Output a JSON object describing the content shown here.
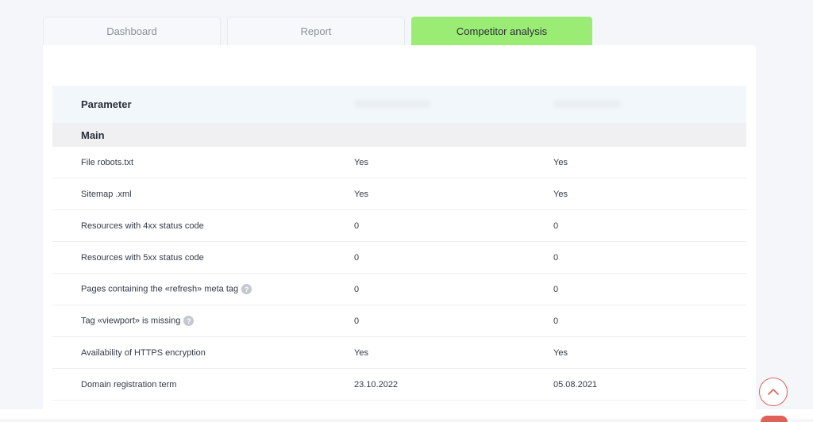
{
  "tabs": [
    {
      "label": "Dashboard",
      "active": false
    },
    {
      "label": "Report",
      "active": false
    },
    {
      "label": "Competitor analysis",
      "active": true
    }
  ],
  "table": {
    "header": {
      "parameter": "Parameter"
    },
    "section": "Main",
    "rows": [
      {
        "label": "File robots.txt",
        "v1": "Yes",
        "v2": "Yes",
        "help": false
      },
      {
        "label": "Sitemap .xml",
        "v1": "Yes",
        "v2": "Yes",
        "help": false
      },
      {
        "label": "Resources with 4xx status code",
        "v1": "0",
        "v2": "0",
        "help": false
      },
      {
        "label": "Resources with 5xx status code",
        "v1": "0",
        "v2": "0",
        "help": false
      },
      {
        "label": "Pages containing the «refresh» meta tag",
        "v1": "0",
        "v2": "0",
        "help": true
      },
      {
        "label": "Tag «viewport» is missing",
        "v1": "0",
        "v2": "0",
        "help": true
      },
      {
        "label": "Availability of HTTPS encryption",
        "v1": "Yes",
        "v2": "Yes",
        "help": false
      },
      {
        "label": "Domain registration term",
        "v1": "23.10.2022",
        "v2": "05.08.2021",
        "help": false
      }
    ]
  },
  "help_icon": "?",
  "colors": {
    "active_tab": "#9bec75",
    "accent": "#e0605a"
  }
}
